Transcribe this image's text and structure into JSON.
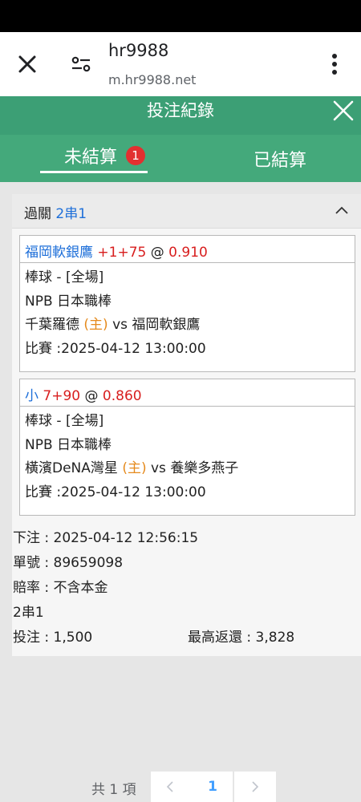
{
  "browser": {
    "host": "hr9988",
    "url": "m.hr9988.net"
  },
  "header": {
    "title": "投注紀錄"
  },
  "tabs": [
    {
      "label": "未結算",
      "badge": "1"
    },
    {
      "label": "已結算"
    }
  ],
  "bet": {
    "type_label": "過關",
    "type_value": "2串1",
    "legs": [
      {
        "pick_team": "福岡軟銀鷹",
        "pick_line": "+1+75",
        "pick_at": "@",
        "pick_odds": "0.910",
        "sport": "棒球 - [全場]",
        "league": "NPB 日本職棒",
        "home_team": "千葉羅德",
        "home_tag": "(主)",
        "vs": "vs",
        "away_team": "福岡軟銀鷹",
        "match_time": "比賽 :2025-04-12 13:00:00"
      },
      {
        "pick_team": "小",
        "pick_line": "7+90",
        "pick_at": "@",
        "pick_odds": "0.860",
        "sport": "棒球 - [全場]",
        "league": "NPB 日本職棒",
        "home_team": "橫濱DeNA灣星",
        "home_tag": "(主)",
        "vs": "vs",
        "away_team": "養樂多燕子",
        "match_time": "比賽 :2025-04-12 13:00:00"
      }
    ],
    "summary": {
      "bet_time": "下注 : 2025-04-12 12:56:15",
      "order_no": "單號 : 89659098",
      "odds_type": "賠率 : 不含本金",
      "combo": "2串1",
      "stake": "投注 : 1,500",
      "max_return": "最高返還 : 3,828"
    }
  },
  "pagination": {
    "total": "共 1 項",
    "current_page": "1"
  },
  "colors": {
    "header_green": "#3c9f75",
    "tabs_green": "#44a97b",
    "badge_red": "#e23030",
    "link_blue": "#1e6fd9",
    "odds_red": "#d81e1e",
    "home_orange": "#e58a1d"
  },
  "icons": [
    "close-icon",
    "site-settings-icon",
    "more-vert-icon",
    "modal-close-icon",
    "chevron-up-icon",
    "chevron-left-icon",
    "chevron-right-icon"
  ]
}
